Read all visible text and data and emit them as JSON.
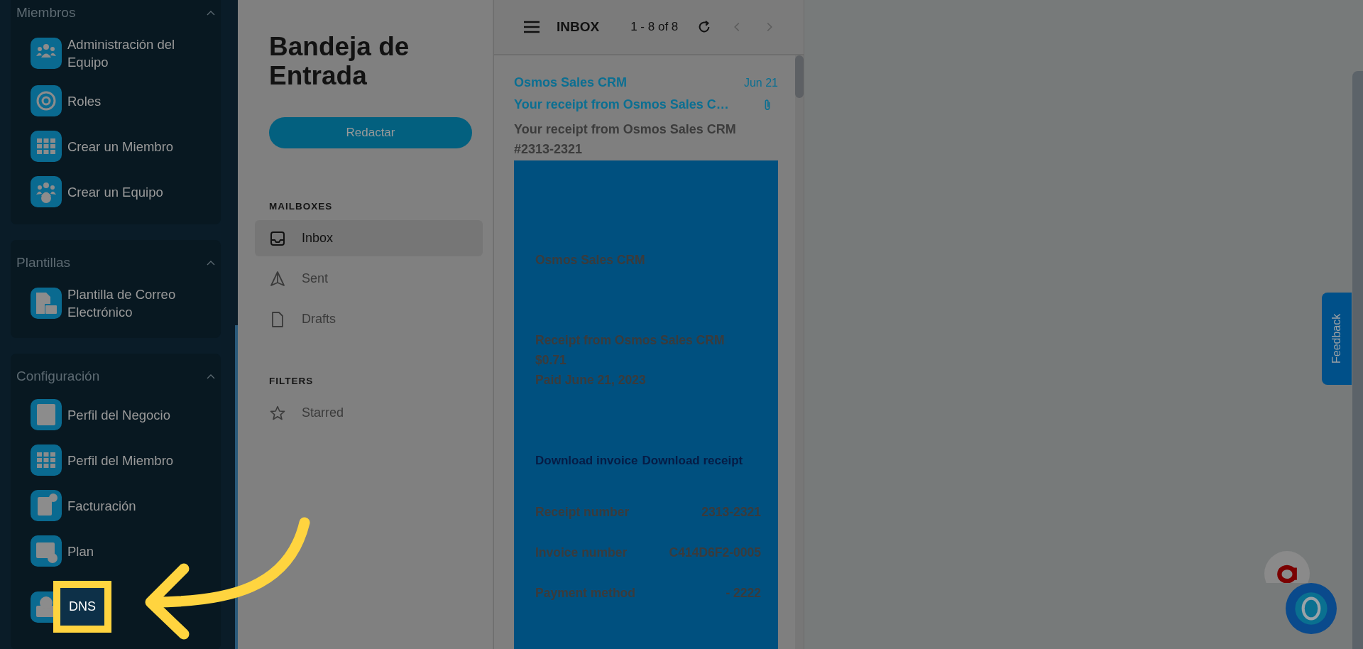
{
  "sidebar": {
    "groups": [
      {
        "title": "Miembros",
        "expanded": true,
        "items": [
          {
            "label": "Administración del Equipo",
            "highlighted": false
          },
          {
            "label": "Roles",
            "highlighted": false
          },
          {
            "label": "Crear un Miembro",
            "highlighted": false
          },
          {
            "label": "Crear un Equipo",
            "highlighted": false
          }
        ]
      },
      {
        "title": "Plantillas",
        "expanded": true,
        "items": [
          {
            "label": "Plantilla de Correo Electrónico",
            "highlighted": false
          }
        ]
      },
      {
        "title": "Configuración",
        "expanded": true,
        "items": [
          {
            "label": "Perfil del Negocio",
            "highlighted": false
          },
          {
            "label": "Perfil del Miembro",
            "highlighted": false
          },
          {
            "label": "Facturación",
            "highlighted": false
          },
          {
            "label": "Plan",
            "highlighted": false
          },
          {
            "label": "DNS",
            "highlighted": true
          }
        ]
      }
    ]
  },
  "mail_nav": {
    "title": "Bandeja de Entrada",
    "compose_button": "Redactar",
    "mailboxes_heading": "MAILBOXES",
    "mailboxes": [
      {
        "label": "Inbox",
        "selected": true
      },
      {
        "label": "Sent",
        "selected": false
      },
      {
        "label": "Drafts",
        "selected": false
      }
    ],
    "filters_heading": "FILTERS",
    "filters": [
      {
        "label": "Starred",
        "selected": false
      }
    ]
  },
  "message_list": {
    "title": "INBOX",
    "range": "1 - 8 of 8",
    "message": {
      "sender": "Osmos Sales CRM",
      "date": "Jun 21",
      "subject": "Your receipt from Osmos Sales C…",
      "attachment": true,
      "preview": "Your receipt from Osmos Sales CRM #2313-2321",
      "body": {
        "brand": "Osmos Sales CRM",
        "lines": [
          "Receipt from Osmos Sales CRM",
          "$0.71",
          "Paid June 21, 2023"
        ],
        "links": [
          "Download invoice",
          "Download receipt"
        ],
        "details": [
          {
            "label": "Receipt number",
            "value": "2313-2321"
          },
          {
            "label": "Invoice number",
            "value": "C414D6F2-0005"
          },
          {
            "label": "Payment method",
            "value": "- 2222"
          }
        ]
      }
    }
  },
  "feedback_tab": "Feedback"
}
